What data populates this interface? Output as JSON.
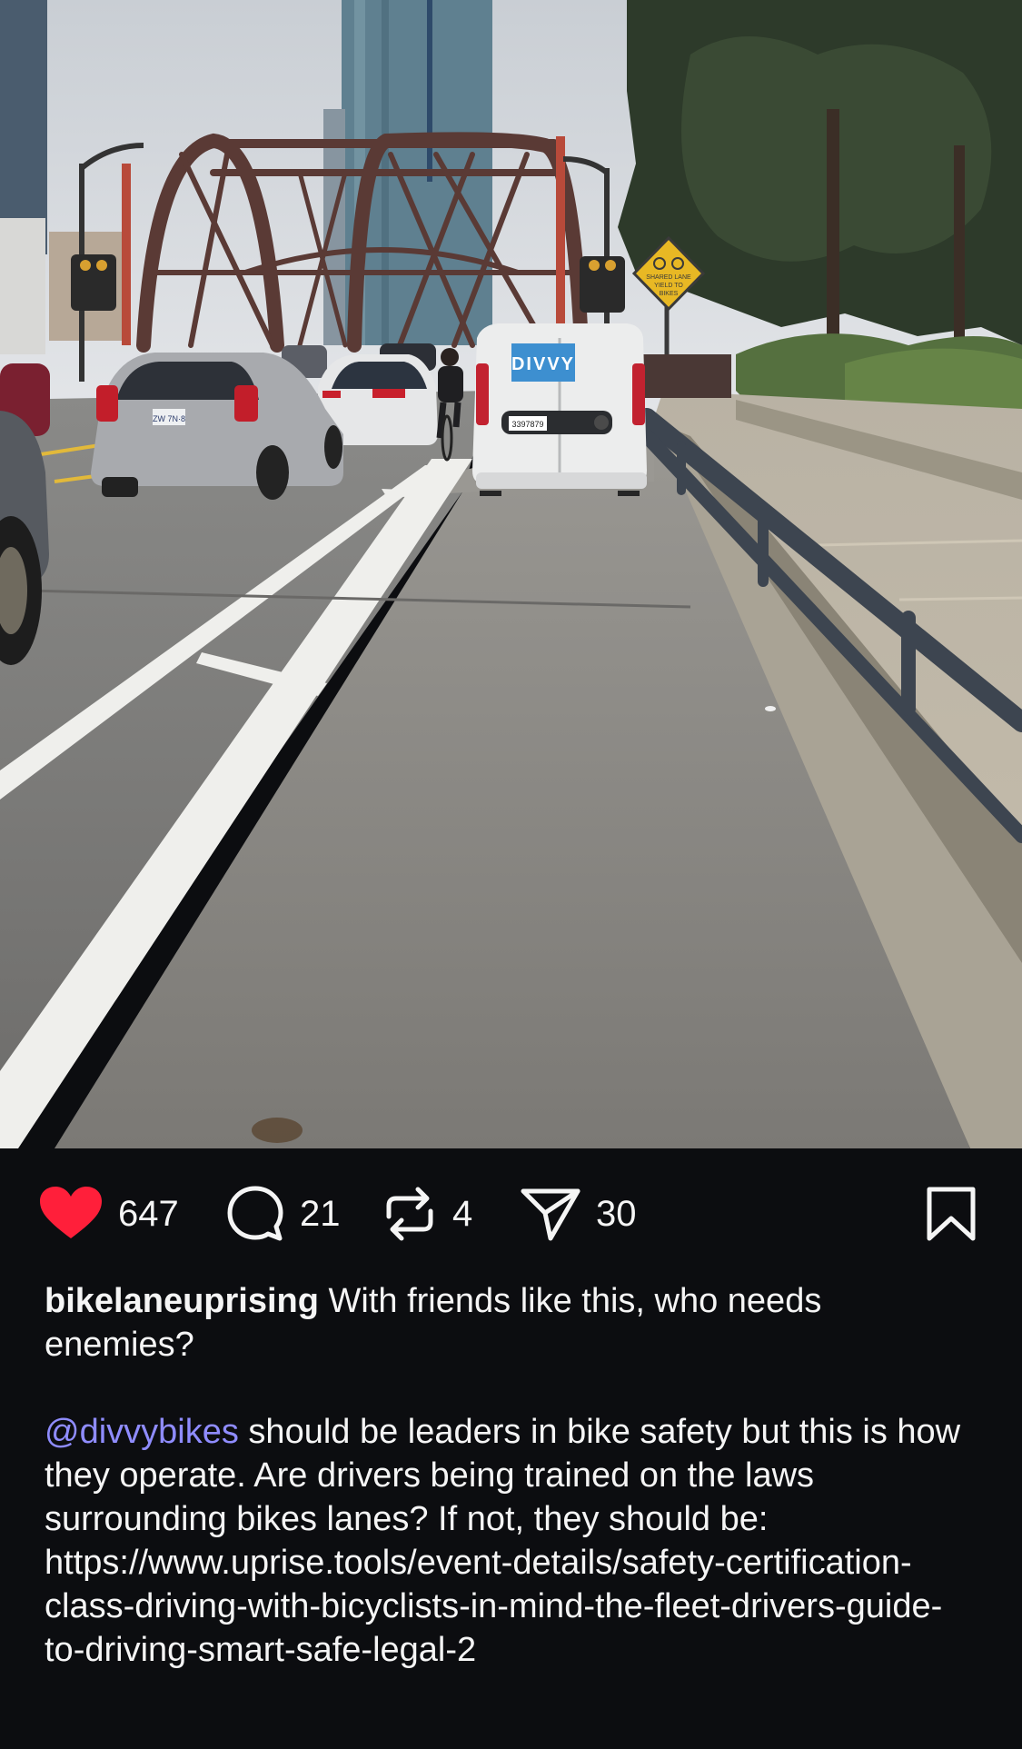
{
  "post": {
    "image": {
      "scene": "bike lane on a river bridge with a truss, cars and a white van parked in the bike lane",
      "van_logo": "DIVVY",
      "sign_text": [
        "SHARED LANE",
        "YIELD TO",
        "BIKES"
      ],
      "plate_left": "ZW 7N·8",
      "plate_van": "3397879"
    },
    "actions": {
      "likes": "647",
      "comments": "21",
      "reposts": "4",
      "shares": "30"
    },
    "caption": {
      "username": "bikelaneuprising",
      "title_text": " With friends like this, who needs enemies?",
      "mention": "@divvybikes",
      "body_text": " should be leaders in bike safety but this is how they operate. Are drivers being trained on the laws surrounding bikes lanes? If not, they should be: https://www.uprise.tools/event-details/safety-certification-class-driving-with-bicyclists-in-mind-the-fleet-drivers-guide-to-driving-smart-safe-legal-2"
    }
  },
  "colors": {
    "background": "#0c0d10",
    "like": "#ff1f3a",
    "mention": "#8f8cff",
    "text": "#f5f5f5"
  },
  "icons": {
    "like": "heart-filled-icon",
    "comment": "speech-bubble-icon",
    "repost": "repost-arrows-icon",
    "share": "paper-plane-icon",
    "save": "bookmark-icon"
  }
}
